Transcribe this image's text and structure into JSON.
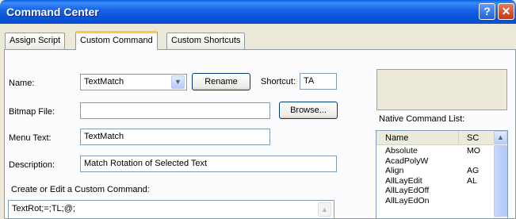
{
  "window": {
    "title": "Command Center",
    "help_glyph": "?",
    "close_glyph": "✕"
  },
  "tabs": [
    {
      "label": "Assign Script",
      "active": false
    },
    {
      "label": "Custom Command",
      "active": true
    },
    {
      "label": "Custom Shortcuts",
      "active": false
    }
  ],
  "form": {
    "name_label": "Name:",
    "name_value": "TextMatch",
    "rename_button": "Rename",
    "shortcut_label": "Shortcut:",
    "shortcut_value": "TA",
    "bitmap_label": "Bitmap File:",
    "bitmap_value": "",
    "browse_button": "Browse...",
    "menu_text_label": "Menu Text:",
    "menu_text_value": "TextMatch",
    "description_label": "Description:",
    "description_value": "Match Rotation of Selected Text",
    "custom_command_label": "Create or Edit a Custom Command:",
    "custom_command_value": "TextRot;=;TL;@;"
  },
  "native_list": {
    "label": "Native Command List:",
    "columns": [
      "Name",
      "SC"
    ],
    "rows": [
      {
        "name": "Absolute",
        "sc": "MO"
      },
      {
        "name": "AcadPolyW",
        "sc": ""
      },
      {
        "name": "Align",
        "sc": "AG"
      },
      {
        "name": "AllLayEdit",
        "sc": "AL"
      },
      {
        "name": "AllLayEdOff",
        "sc": ""
      },
      {
        "name": "AllLayEdOn",
        "sc": ""
      }
    ]
  }
}
